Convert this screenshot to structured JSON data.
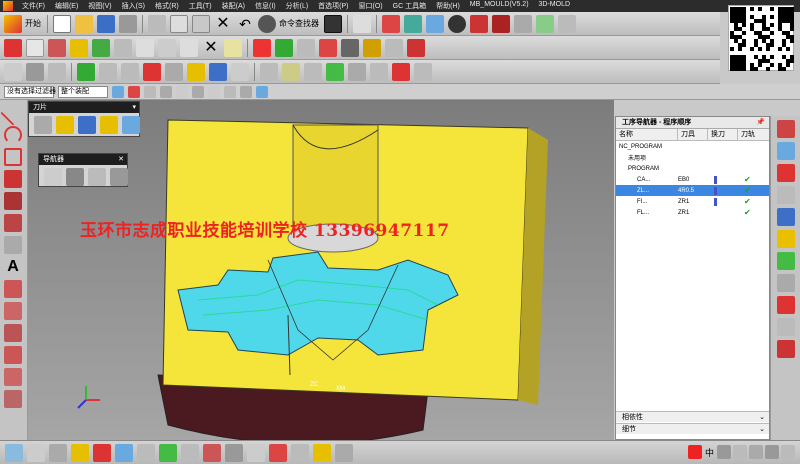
{
  "menubar": {
    "items": [
      "文件(F)",
      "编辑(E)",
      "视图(V)",
      "插入(S)",
      "格式(R)",
      "工具(T)",
      "装配(A)",
      "信息(I)",
      "分析(L)",
      "首选项(P)",
      "窗口(O)",
      "GC 工具箱",
      "帮助(H)",
      "MB_MOULD(V5.2)",
      "3D-MOLD"
    ]
  },
  "toolbar": {
    "start_label": "开始",
    "command_finder_label": "命令查找器"
  },
  "selection_bar": {
    "filter_value": "没有选择过滤器",
    "assembly_value": "整个装配"
  },
  "panels": {
    "cutter_title": "刀片",
    "navigator_title": "导航器"
  },
  "watermark_text": "玉环市志成职业技能培训学校  13396947117",
  "operation_navigator": {
    "title": "工序导航器 - 程序顺序",
    "columns": [
      "名称",
      "刀具",
      "换刀",
      "刀轨"
    ],
    "rows": [
      {
        "name": "NC_PROGRAM",
        "tool": "",
        "change": false,
        "check": false,
        "selected": false,
        "indent": 0
      },
      {
        "name": "未用项",
        "tool": "",
        "change": false,
        "check": false,
        "selected": false,
        "indent": 1
      },
      {
        "name": "PROGRAM",
        "tool": "",
        "change": false,
        "check": false,
        "selected": false,
        "indent": 1
      },
      {
        "name": "CA...",
        "tool": "EB0",
        "change": true,
        "check": true,
        "selected": false,
        "indent": 2
      },
      {
        "name": "ZL...",
        "tool": "4R0.5",
        "change": true,
        "check": true,
        "selected": true,
        "indent": 2
      },
      {
        "name": "FI...",
        "tool": "ZR1",
        "change": true,
        "check": true,
        "selected": false,
        "indent": 2
      },
      {
        "name": "FL...",
        "tool": "ZR1",
        "change": false,
        "check": true,
        "selected": false,
        "indent": 2
      }
    ],
    "dependencies_label": "相依性",
    "details_label": "细节",
    "check_glyph": "✔"
  },
  "viewport": {
    "axis_zc": "ZC",
    "axis_xm": "XM"
  },
  "statusbar": {
    "ime_label": "中"
  },
  "colors": {
    "part_yellow": "#f5e43a",
    "cut_cyan": "#4fd7ea",
    "selected_row": "#3a86e0",
    "watermark_red": "#e22222"
  }
}
